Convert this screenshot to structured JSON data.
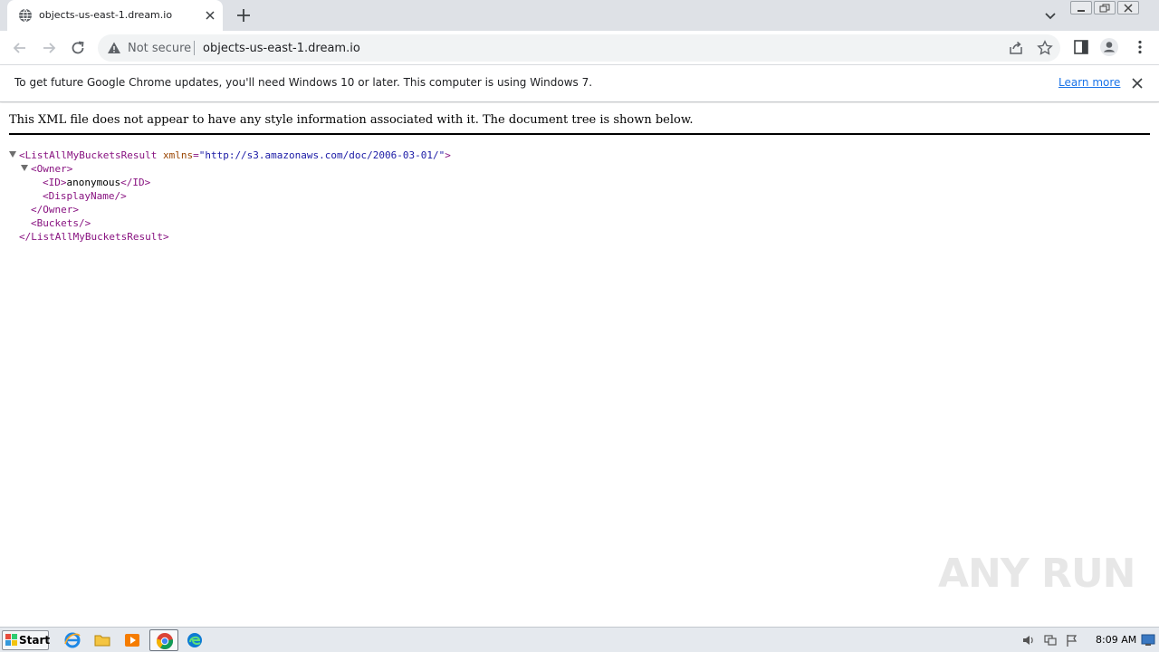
{
  "browser": {
    "tab_title": "objects-us-east-1.dream.io",
    "security_label": "Not secure",
    "url": "objects-us-east-1.dream.io"
  },
  "infobar": {
    "message": "To get future Google Chrome updates, you'll need Windows 10 or later. This computer is using Windows 7.",
    "link": "Learn more"
  },
  "page": {
    "header": "This XML file does not appear to have any style information associated with it. The document tree is shown below.",
    "tree": {
      "root_open_name": "<ListAllMyBucketsResult",
      "root_attr_name": "xmlns",
      "root_attr_eq": "=",
      "root_attr_value": "\"http://s3.amazonaws.com/doc/2006-03-01/\"",
      "root_open_end": ">",
      "owner_open": "<Owner>",
      "id_open": "<ID>",
      "id_value": "anonymous",
      "id_close": "</ID>",
      "display_name": "<DisplayName/>",
      "owner_close": "</Owner>",
      "buckets": "<Buckets/>",
      "root_close": "</ListAllMyBucketsResult>"
    },
    "watermark": "ANY RUN"
  },
  "taskbar": {
    "start_label": "Start",
    "clock": "8:09 AM"
  },
  "icons": {
    "tab": "globe-icon",
    "security": "warning-triangle-icon",
    "taskbar": [
      "internet-explorer-icon",
      "file-explorer-icon",
      "media-player-icon",
      "chrome-icon",
      "edge-icon"
    ]
  },
  "colors": {
    "tag": "#881280",
    "attribute": "#994500",
    "attribute_value": "#1a1aa6",
    "link": "#1a73e8"
  }
}
